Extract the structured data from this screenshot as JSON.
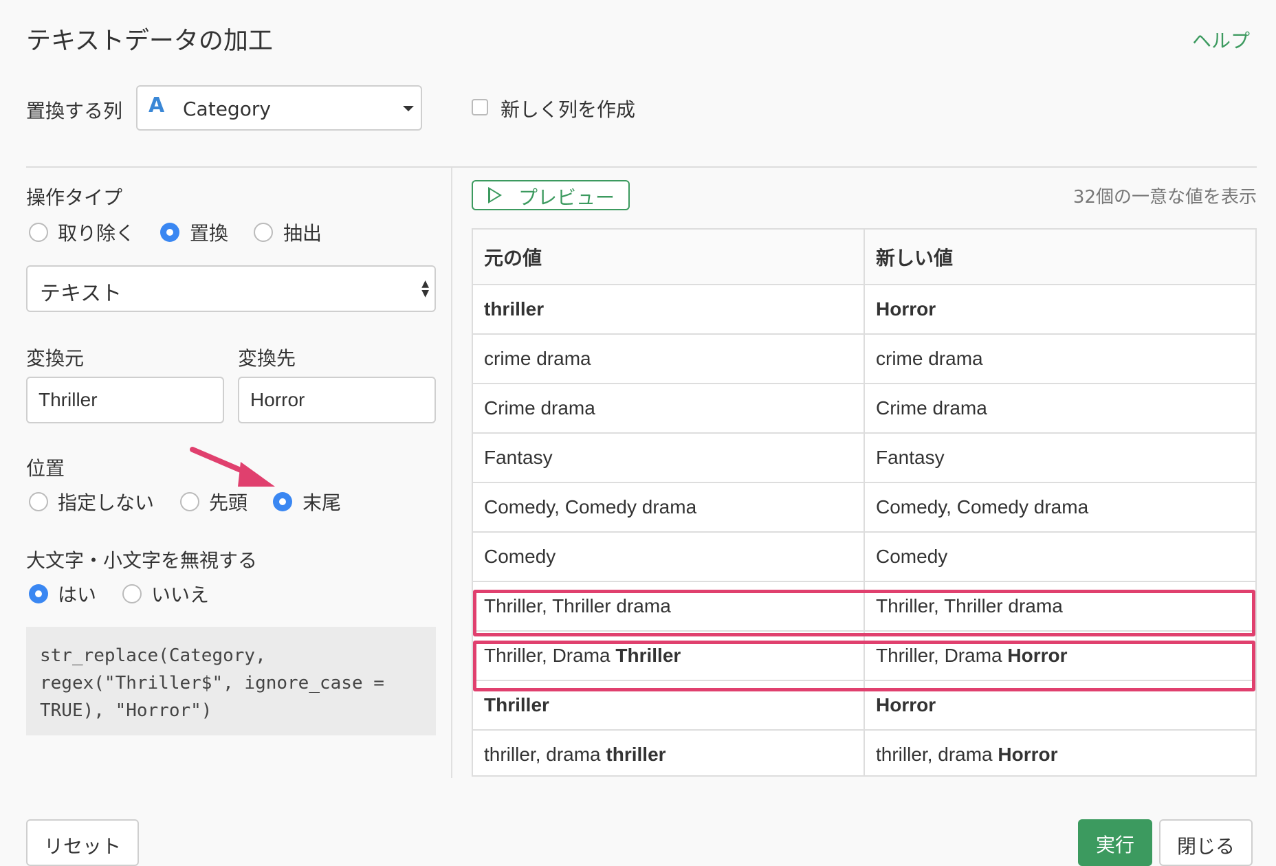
{
  "dialog": {
    "title": "テキストデータの加工",
    "help_label": "ヘルプ"
  },
  "target_column": {
    "label": "置換する列",
    "type_icon": "A",
    "value": "Category",
    "new_column_label": "新しく列を作成",
    "new_column_checked": false
  },
  "operation": {
    "label": "操作タイプ",
    "options": [
      "取り除く",
      "置換",
      "抽出"
    ],
    "selected": "置換",
    "mode_select_value": "テキスト"
  },
  "replace": {
    "from_label": "変換元",
    "from_value": "Thriller",
    "to_label": "変換先",
    "to_value": "Horror"
  },
  "position": {
    "label": "位置",
    "options": [
      "指定しない",
      "先頭",
      "末尾"
    ],
    "selected": "末尾"
  },
  "ignore_case": {
    "label": "大文字・小文字を無視する",
    "options": [
      "はい",
      "いいえ"
    ],
    "selected": "はい"
  },
  "code_preview": "str_replace(Category,\nregex(\"Thriller$\", ignore_case =\nTRUE), \"Horror\")",
  "preview": {
    "button_label": "プレビュー",
    "count_text": "32個の一意な値を表示",
    "headers": [
      "元の値",
      "新しい値"
    ],
    "rows": [
      {
        "orig": [
          {
            "t": "thriller",
            "b": true
          }
        ],
        "new": [
          {
            "t": "Horror",
            "b": true
          }
        ]
      },
      {
        "orig": [
          {
            "t": "crime drama",
            "b": false
          }
        ],
        "new": [
          {
            "t": "crime drama",
            "b": false
          }
        ]
      },
      {
        "orig": [
          {
            "t": "Crime drama",
            "b": false
          }
        ],
        "new": [
          {
            "t": "Crime drama",
            "b": false
          }
        ]
      },
      {
        "orig": [
          {
            "t": "Fantasy",
            "b": false
          }
        ],
        "new": [
          {
            "t": "Fantasy",
            "b": false
          }
        ]
      },
      {
        "orig": [
          {
            "t": "Comedy, Comedy drama",
            "b": false
          }
        ],
        "new": [
          {
            "t": "Comedy, Comedy drama",
            "b": false
          }
        ]
      },
      {
        "orig": [
          {
            "t": "Comedy",
            "b": false
          }
        ],
        "new": [
          {
            "t": "Comedy",
            "b": false
          }
        ]
      },
      {
        "orig": [
          {
            "t": "Thriller, Thriller drama",
            "b": false
          }
        ],
        "new": [
          {
            "t": "Thriller, Thriller drama",
            "b": false
          }
        ],
        "highlight": true
      },
      {
        "orig": [
          {
            "t": "Thriller, Drama ",
            "b": false
          },
          {
            "t": "Thriller",
            "b": true
          }
        ],
        "new": [
          {
            "t": "Thriller, Drama ",
            "b": false
          },
          {
            "t": "Horror",
            "b": true
          }
        ],
        "highlight": true
      },
      {
        "orig": [
          {
            "t": "Thriller",
            "b": true
          }
        ],
        "new": [
          {
            "t": "Horror",
            "b": true
          }
        ]
      },
      {
        "orig": [
          {
            "t": "thriller, drama ",
            "b": false
          },
          {
            "t": "thriller",
            "b": true
          }
        ],
        "new": [
          {
            "t": "thriller, drama ",
            "b": false
          },
          {
            "t": "Horror",
            "b": true
          }
        ]
      }
    ]
  },
  "footer": {
    "reset_label": "リセット",
    "run_label": "実行",
    "close_label": "閉じる"
  },
  "colors": {
    "accent_green": "#3c9a5f",
    "radio_blue": "#3a87f2",
    "highlight_pink": "#e0406e"
  }
}
